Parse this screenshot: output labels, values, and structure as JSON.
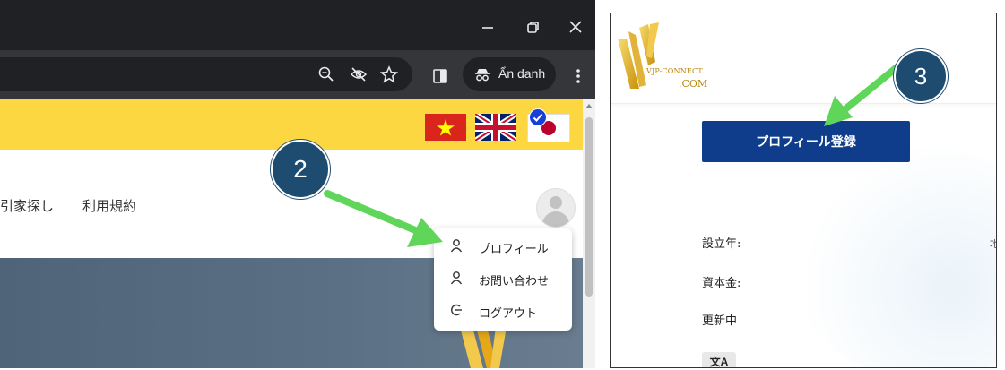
{
  "browser": {
    "incognito_label": "Ẩn danh",
    "window_controls": [
      "minimize-icon",
      "restore-icon",
      "close-icon"
    ],
    "toolbar_icons": [
      "zoom-icon",
      "eye-off-icon",
      "star-icon",
      "sidebar-icon",
      "menu-icon"
    ]
  },
  "site_left": {
    "flags": [
      "flag-vietnam",
      "flag-uk",
      "flag-japan"
    ],
    "nav_links": [
      "引家探し",
      "利用規約"
    ],
    "menu_items": [
      {
        "label": "プロフィール",
        "icon": "person-icon"
      },
      {
        "label": "お問い合わせ",
        "icon": "person-icon"
      },
      {
        "label": "ログアウト",
        "icon": "logout-icon"
      }
    ]
  },
  "annotations": {
    "step_2": "2",
    "step_3": "3",
    "arrow_color": "#5fd55a",
    "badge_color": "#1e4c70"
  },
  "site_right": {
    "logo_text_1": "VJP-CONNECT",
    "logo_text_2": ".COM",
    "profile_button": "プロフィール登録",
    "fields": [
      "設立年:",
      "資本金:",
      "更新中"
    ],
    "partial_char": "地",
    "translate_icon": "文A"
  },
  "colors": {
    "yellow": "#fcd742",
    "navy_button": "#0f3d8b",
    "chrome_dark": "#202124",
    "chrome_toolbar": "#35363a"
  }
}
